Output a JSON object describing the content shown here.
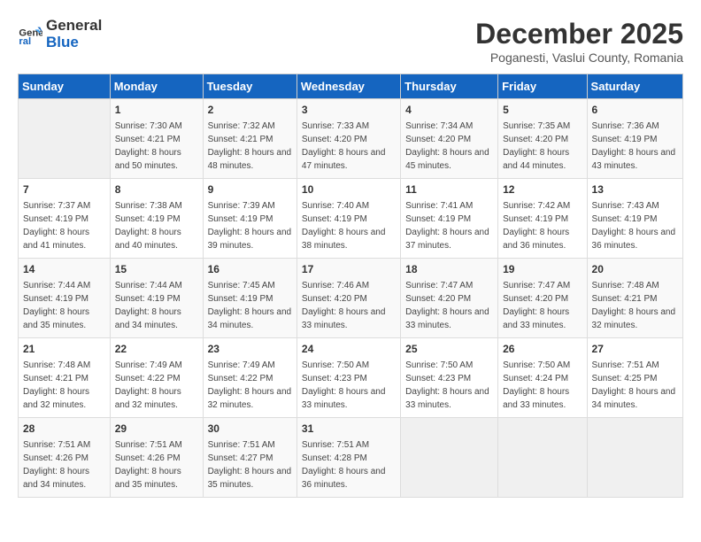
{
  "logo": {
    "line1": "General",
    "line2": "Blue"
  },
  "title": "December 2025",
  "subtitle": "Poganesti, Vaslui County, Romania",
  "days_of_week": [
    "Sunday",
    "Monday",
    "Tuesday",
    "Wednesday",
    "Thursday",
    "Friday",
    "Saturday"
  ],
  "weeks": [
    [
      {
        "day": "",
        "sunrise": "",
        "sunset": "",
        "daylight": ""
      },
      {
        "day": "1",
        "sunrise": "Sunrise: 7:30 AM",
        "sunset": "Sunset: 4:21 PM",
        "daylight": "Daylight: 8 hours and 50 minutes."
      },
      {
        "day": "2",
        "sunrise": "Sunrise: 7:32 AM",
        "sunset": "Sunset: 4:21 PM",
        "daylight": "Daylight: 8 hours and 48 minutes."
      },
      {
        "day": "3",
        "sunrise": "Sunrise: 7:33 AM",
        "sunset": "Sunset: 4:20 PM",
        "daylight": "Daylight: 8 hours and 47 minutes."
      },
      {
        "day": "4",
        "sunrise": "Sunrise: 7:34 AM",
        "sunset": "Sunset: 4:20 PM",
        "daylight": "Daylight: 8 hours and 45 minutes."
      },
      {
        "day": "5",
        "sunrise": "Sunrise: 7:35 AM",
        "sunset": "Sunset: 4:20 PM",
        "daylight": "Daylight: 8 hours and 44 minutes."
      },
      {
        "day": "6",
        "sunrise": "Sunrise: 7:36 AM",
        "sunset": "Sunset: 4:19 PM",
        "daylight": "Daylight: 8 hours and 43 minutes."
      }
    ],
    [
      {
        "day": "7",
        "sunrise": "Sunrise: 7:37 AM",
        "sunset": "Sunset: 4:19 PM",
        "daylight": "Daylight: 8 hours and 41 minutes."
      },
      {
        "day": "8",
        "sunrise": "Sunrise: 7:38 AM",
        "sunset": "Sunset: 4:19 PM",
        "daylight": "Daylight: 8 hours and 40 minutes."
      },
      {
        "day": "9",
        "sunrise": "Sunrise: 7:39 AM",
        "sunset": "Sunset: 4:19 PM",
        "daylight": "Daylight: 8 hours and 39 minutes."
      },
      {
        "day": "10",
        "sunrise": "Sunrise: 7:40 AM",
        "sunset": "Sunset: 4:19 PM",
        "daylight": "Daylight: 8 hours and 38 minutes."
      },
      {
        "day": "11",
        "sunrise": "Sunrise: 7:41 AM",
        "sunset": "Sunset: 4:19 PM",
        "daylight": "Daylight: 8 hours and 37 minutes."
      },
      {
        "day": "12",
        "sunrise": "Sunrise: 7:42 AM",
        "sunset": "Sunset: 4:19 PM",
        "daylight": "Daylight: 8 hours and 36 minutes."
      },
      {
        "day": "13",
        "sunrise": "Sunrise: 7:43 AM",
        "sunset": "Sunset: 4:19 PM",
        "daylight": "Daylight: 8 hours and 36 minutes."
      }
    ],
    [
      {
        "day": "14",
        "sunrise": "Sunrise: 7:44 AM",
        "sunset": "Sunset: 4:19 PM",
        "daylight": "Daylight: 8 hours and 35 minutes."
      },
      {
        "day": "15",
        "sunrise": "Sunrise: 7:44 AM",
        "sunset": "Sunset: 4:19 PM",
        "daylight": "Daylight: 8 hours and 34 minutes."
      },
      {
        "day": "16",
        "sunrise": "Sunrise: 7:45 AM",
        "sunset": "Sunset: 4:19 PM",
        "daylight": "Daylight: 8 hours and 34 minutes."
      },
      {
        "day": "17",
        "sunrise": "Sunrise: 7:46 AM",
        "sunset": "Sunset: 4:20 PM",
        "daylight": "Daylight: 8 hours and 33 minutes."
      },
      {
        "day": "18",
        "sunrise": "Sunrise: 7:47 AM",
        "sunset": "Sunset: 4:20 PM",
        "daylight": "Daylight: 8 hours and 33 minutes."
      },
      {
        "day": "19",
        "sunrise": "Sunrise: 7:47 AM",
        "sunset": "Sunset: 4:20 PM",
        "daylight": "Daylight: 8 hours and 33 minutes."
      },
      {
        "day": "20",
        "sunrise": "Sunrise: 7:48 AM",
        "sunset": "Sunset: 4:21 PM",
        "daylight": "Daylight: 8 hours and 32 minutes."
      }
    ],
    [
      {
        "day": "21",
        "sunrise": "Sunrise: 7:48 AM",
        "sunset": "Sunset: 4:21 PM",
        "daylight": "Daylight: 8 hours and 32 minutes."
      },
      {
        "day": "22",
        "sunrise": "Sunrise: 7:49 AM",
        "sunset": "Sunset: 4:22 PM",
        "daylight": "Daylight: 8 hours and 32 minutes."
      },
      {
        "day": "23",
        "sunrise": "Sunrise: 7:49 AM",
        "sunset": "Sunset: 4:22 PM",
        "daylight": "Daylight: 8 hours and 32 minutes."
      },
      {
        "day": "24",
        "sunrise": "Sunrise: 7:50 AM",
        "sunset": "Sunset: 4:23 PM",
        "daylight": "Daylight: 8 hours and 33 minutes."
      },
      {
        "day": "25",
        "sunrise": "Sunrise: 7:50 AM",
        "sunset": "Sunset: 4:23 PM",
        "daylight": "Daylight: 8 hours and 33 minutes."
      },
      {
        "day": "26",
        "sunrise": "Sunrise: 7:50 AM",
        "sunset": "Sunset: 4:24 PM",
        "daylight": "Daylight: 8 hours and 33 minutes."
      },
      {
        "day": "27",
        "sunrise": "Sunrise: 7:51 AM",
        "sunset": "Sunset: 4:25 PM",
        "daylight": "Daylight: 8 hours and 34 minutes."
      }
    ],
    [
      {
        "day": "28",
        "sunrise": "Sunrise: 7:51 AM",
        "sunset": "Sunset: 4:26 PM",
        "daylight": "Daylight: 8 hours and 34 minutes."
      },
      {
        "day": "29",
        "sunrise": "Sunrise: 7:51 AM",
        "sunset": "Sunset: 4:26 PM",
        "daylight": "Daylight: 8 hours and 35 minutes."
      },
      {
        "day": "30",
        "sunrise": "Sunrise: 7:51 AM",
        "sunset": "Sunset: 4:27 PM",
        "daylight": "Daylight: 8 hours and 35 minutes."
      },
      {
        "day": "31",
        "sunrise": "Sunrise: 7:51 AM",
        "sunset": "Sunset: 4:28 PM",
        "daylight": "Daylight: 8 hours and 36 minutes."
      },
      {
        "day": "",
        "sunrise": "",
        "sunset": "",
        "daylight": ""
      },
      {
        "day": "",
        "sunrise": "",
        "sunset": "",
        "daylight": ""
      },
      {
        "day": "",
        "sunrise": "",
        "sunset": "",
        "daylight": ""
      }
    ]
  ]
}
